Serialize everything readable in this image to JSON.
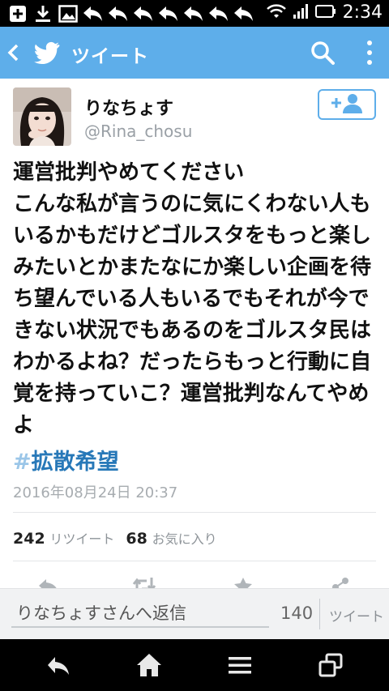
{
  "status_bar": {
    "time": "2:34",
    "icons": [
      "add-icon",
      "download-icon",
      "image-icon",
      "reply-icon",
      "reply-icon",
      "reply-icon",
      "reply-icon",
      "reply-icon",
      "reply-icon",
      "reply-icon",
      "wifi-icon",
      "signal-icon",
      "battery-icon"
    ]
  },
  "header": {
    "title": "ツイート"
  },
  "tweet": {
    "display_name": "りなちょす",
    "handle": "@Rina_chosu",
    "text": "運営批判やめてください\nこんな私が言うのに気にくわない人もいるかもだけどゴルスタをもっと楽しみたいとかまたなにか楽しい企画を待ち望んでいる人もいるでもそれが今できない状況でもあるのをゴルスタ民はわかるよね？だったらもっと行動に自覚を持っていこ？運営批判なんてやめよ",
    "hashtag_symbol": "#",
    "hashtag_text": "拡散希望",
    "timestamp": "2016年08月24日 20:37",
    "retweet_count": "242",
    "retweet_label": "リツイート",
    "favorite_count": "68",
    "favorite_label": "お気に入り"
  },
  "reply": {
    "placeholder": "りなちょすさんへ返信",
    "char_count": "140",
    "send_label": "ツイート"
  },
  "colors": {
    "accent": "#5eaeea",
    "hashtag": "#2778b8"
  }
}
